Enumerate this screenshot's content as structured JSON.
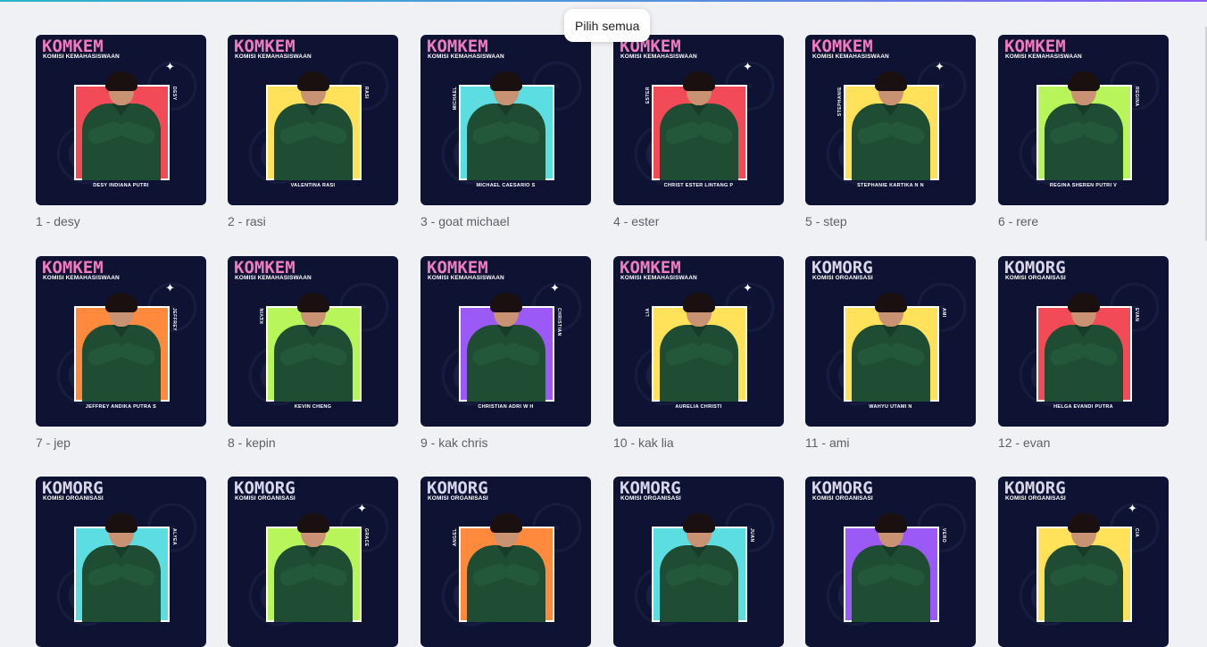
{
  "tooltip": {
    "label": "Pilih semua"
  },
  "colors": {
    "accent": "#7d2ae8",
    "background": "#f0f1f5",
    "card_bg": "#0e1333",
    "komkem_pink": "#f07bbf",
    "komorg_lilac": "#d8d6ea"
  },
  "cards": [
    {
      "caption": "1 - desy",
      "brand": "KOMKEM",
      "subtitle": "KOMISI KEMAHASISWAAN",
      "fullname": "DESY INDIANA PUTRI",
      "nickname": "DESY",
      "bg": "#f24a57",
      "icon": "sparkle-icon"
    },
    {
      "caption": "2 - rasi",
      "brand": "KOMKEM",
      "subtitle": "KOMISI KEMAHASISWAAN",
      "fullname": "VALENTINA RASI",
      "nickname": "RASI",
      "bg": "#ffe15a",
      "icon": ""
    },
    {
      "caption": "3 - goat michael",
      "brand": "KOMKEM",
      "subtitle": "KOMISI KEMAHASISWAAN",
      "fullname": "MICHAEL CAESARIO S",
      "nickname": "MICHAEL",
      "bg": "#5cdde2",
      "icon": ""
    },
    {
      "caption": "4 - ester",
      "brand": "KOMKEM",
      "subtitle": "KOMISI KEMAHASISWAAN",
      "fullname": "CHRIST ESTER LINTANG P",
      "nickname": "ESTER",
      "bg": "#f24a57",
      "icon": "sparkle-icon"
    },
    {
      "caption": "5 - step",
      "brand": "KOMKEM",
      "subtitle": "KOMISI KEMAHASISWAAN",
      "fullname": "STEPHANIE KARTIKA N N",
      "nickname": "STEPHANIE",
      "bg": "#ffe15a",
      "icon": "sparkle-icon"
    },
    {
      "caption": "6 - rere",
      "brand": "KOMKEM",
      "subtitle": "KOMISI KEMAHASISWAAN",
      "fullname": "REGINA SHEREN PUTRI V",
      "nickname": "REGINA",
      "bg": "#b8f55a",
      "icon": ""
    },
    {
      "caption": "7 - jep",
      "brand": "KOMKEM",
      "subtitle": "KOMISI KEMAHASISWAAN",
      "fullname": "JEFFREY ANDIKA PUTRA S",
      "nickname": "JEFFREY",
      "bg": "#ff8a3d",
      "icon": "sparkle-icon"
    },
    {
      "caption": "8 - kepin",
      "brand": "KOMKEM",
      "subtitle": "KOMISI KEMAHASISWAAN",
      "fullname": "KEVIN CHENG",
      "nickname": "KEVIN",
      "bg": "#b8f55a",
      "icon": ""
    },
    {
      "caption": "9 - kak chris",
      "brand": "KOMKEM",
      "subtitle": "KOMISI KEMAHASISWAAN",
      "fullname": "CHRISTIAN ADRI W H",
      "nickname": "CHRISTIAN",
      "bg": "#9b59f5",
      "icon": "sparkle-icon"
    },
    {
      "caption": "10 - kak lia",
      "brand": "KOMKEM",
      "subtitle": "KOMISI KEMAHASISWAAN",
      "fullname": "AURELIA CHRISTI",
      "nickname": "LIA",
      "bg": "#ffe15a",
      "icon": "sparkle-icon"
    },
    {
      "caption": "11 - ami",
      "brand": "KOMORG",
      "subtitle": "KOMISI ORGANISASI",
      "fullname": "WAHYU UTAMI N",
      "nickname": "AMI",
      "bg": "#ffe15a",
      "icon": ""
    },
    {
      "caption": "12 - evan",
      "brand": "KOMORG",
      "subtitle": "KOMISI ORGANISASI",
      "fullname": "HELGA EVANDI PUTRA",
      "nickname": "EVAN",
      "bg": "#f24a57",
      "icon": ""
    },
    {
      "caption": "",
      "brand": "KOMORG",
      "subtitle": "KOMISI ORGANISASI",
      "fullname": "",
      "nickname": "ALYEA",
      "bg": "#5cdde2",
      "icon": ""
    },
    {
      "caption": "",
      "brand": "KOMORG",
      "subtitle": "KOMISI ORGANISASI",
      "fullname": "",
      "nickname": "GRACE",
      "bg": "#b8f55a",
      "icon": "sparkle-icon"
    },
    {
      "caption": "",
      "brand": "KOMORG",
      "subtitle": "KOMISI ORGANISASI",
      "fullname": "",
      "nickname": "ANGEL",
      "bg": "#ff8a3d",
      "icon": ""
    },
    {
      "caption": "",
      "brand": "KOMORG",
      "subtitle": "KOMISI ORGANISASI",
      "fullname": "",
      "nickname": "JUAN",
      "bg": "#5cdde2",
      "icon": ""
    },
    {
      "caption": "",
      "brand": "KOMORG",
      "subtitle": "KOMISI ORGANISASI",
      "fullname": "",
      "nickname": "VERO",
      "bg": "#9b59f5",
      "icon": ""
    },
    {
      "caption": "",
      "brand": "KOMORG",
      "subtitle": "KOMISI ORGANISASI",
      "fullname": "",
      "nickname": "CIA",
      "bg": "#ffe15a",
      "icon": "sparkle-icon"
    }
  ]
}
